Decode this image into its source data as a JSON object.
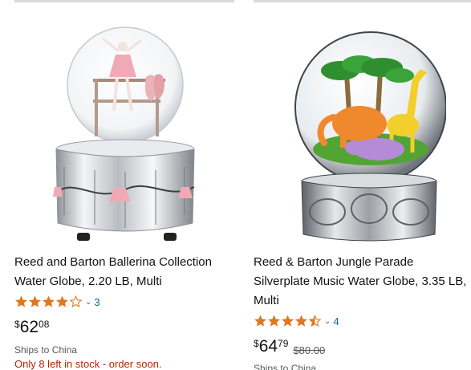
{
  "products": [
    {
      "title": "Reed and Barton Ballerina Collection Water Globe, 2.20 LB, Multi",
      "rating_stars": 4.0,
      "rating_count": "3",
      "price_symbol": "$",
      "price_whole": "62",
      "price_fraction": "08",
      "list_price": "",
      "shipping": "Ships to China",
      "stock": "Only 8 left in stock - order soon."
    },
    {
      "title": "Reed & Barton Jungle Parade Silverplate Music Water Globe, 3.35 LB, Multi",
      "rating_stars": 4.5,
      "rating_count": "4",
      "price_symbol": "$",
      "price_whole": "64",
      "price_fraction": "79",
      "list_price": "$80.00",
      "shipping": "Ships to China"
    }
  ],
  "colors": {
    "link": "#007185",
    "star": "#de7921",
    "stock_warning": "#b12704"
  }
}
